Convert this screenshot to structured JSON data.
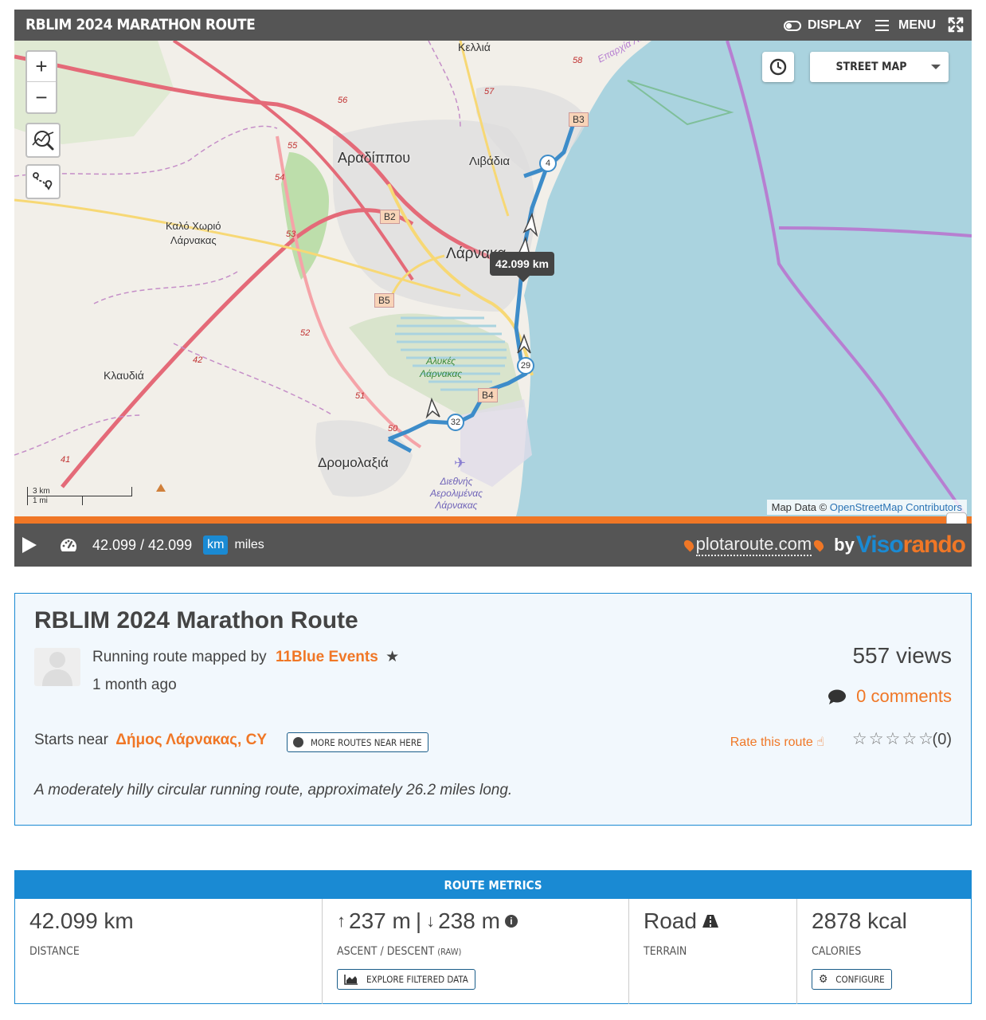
{
  "map_widget": {
    "title": "RBLIM 2024 MARATHON ROUTE",
    "display_label": "DISPLAY",
    "menu_label": "MENU",
    "zoom_in_label": "+",
    "zoom_out_label": "−",
    "street_map_label": "STREET MAP",
    "tooltip_distance": "42.099 km",
    "attribution_prefix": "Map Data ©",
    "attribution_link": "OpenStreetMap Contributors",
    "scale_km": "3 km",
    "scale_mi": "1 mi",
    "place_labels": [
      {
        "name": "Κελλιά"
      },
      {
        "name": "Αραδίππου"
      },
      {
        "name": "Λιβάδια"
      },
      {
        "name": "Καλό Χωριό\nΛάρνακας"
      },
      {
        "name": "Λάρνακα"
      },
      {
        "name": "Κλαυδιά"
      },
      {
        "name": "Αλυκές\nΛάρνακας"
      },
      {
        "name": "Δρομολαξιά"
      },
      {
        "name": "Διεθνής\nΑερολιμένας\nΛάρνακας"
      },
      {
        "name": "Επαρχία Λάρνακας"
      }
    ],
    "road_labels": [
      "B2",
      "B5",
      "B3",
      "B4",
      "56",
      "57",
      "58",
      "55",
      "54",
      "53",
      "52",
      "51",
      "50",
      "42",
      "41"
    ],
    "km_markers": [
      "4",
      "29",
      "32"
    ],
    "distance_readout": "42.099 / 42.099",
    "unit_km": "km",
    "unit_miles": "miles",
    "brand_text": "plotaroute.com",
    "brand_by": "by",
    "brand_viso": "Viso",
    "brand_rando": "rando",
    "progress_fraction": 1.0
  },
  "info": {
    "route_title": "RBLIM 2024 Marathon Route",
    "mapped_by_prefix": "Running route mapped by",
    "author": "11Blue Events",
    "posted_ago": "1 month ago",
    "views": "557 views",
    "comments": "0 comments",
    "starts_near_prefix": "Starts near",
    "starts_near_place": "Δήμος Λάρνακας, CY",
    "more_routes_label": "MORE ROUTES NEAR HERE",
    "rate_label": "Rate this route",
    "rating_stars": 0,
    "rating_count": "(0)",
    "description": "A moderately hilly circular running route, approximately 26.2 miles long."
  },
  "metrics": {
    "header": "ROUTE METRICS",
    "distance_value": "42.099 km",
    "distance_label": "DISTANCE",
    "ascent_value": "237 m",
    "separator": "|",
    "descent_value": "238 m",
    "ascent_label": "ASCENT / DESCENT",
    "ascent_label_raw": "(RAW)",
    "explore_label": "EXPLORE FILTERED DATA",
    "terrain_value": "Road",
    "terrain_label": "TERRAIN",
    "calories_value": "2878 kcal",
    "calories_label": "CALORIES",
    "configure_label": "CONFIGURE"
  },
  "colors": {
    "accent_blue": "#1a8ad3",
    "accent_orange": "#f07726",
    "route_line": "#3d8cc9",
    "sea": "#aad3df",
    "land": "#f2efe9"
  },
  "icons": [
    "toggle-icon",
    "menu-icon",
    "fullscreen-icon",
    "elevation-profile-icon",
    "route-edit-icon",
    "clock-icon",
    "play-icon",
    "speedometer-icon",
    "star-icon",
    "comment-icon",
    "globe-icon",
    "thumbs-up-icon",
    "arrow-up-icon",
    "arrow-down-icon",
    "info-icon",
    "road-icon",
    "area-chart-icon",
    "gear-icon"
  ]
}
